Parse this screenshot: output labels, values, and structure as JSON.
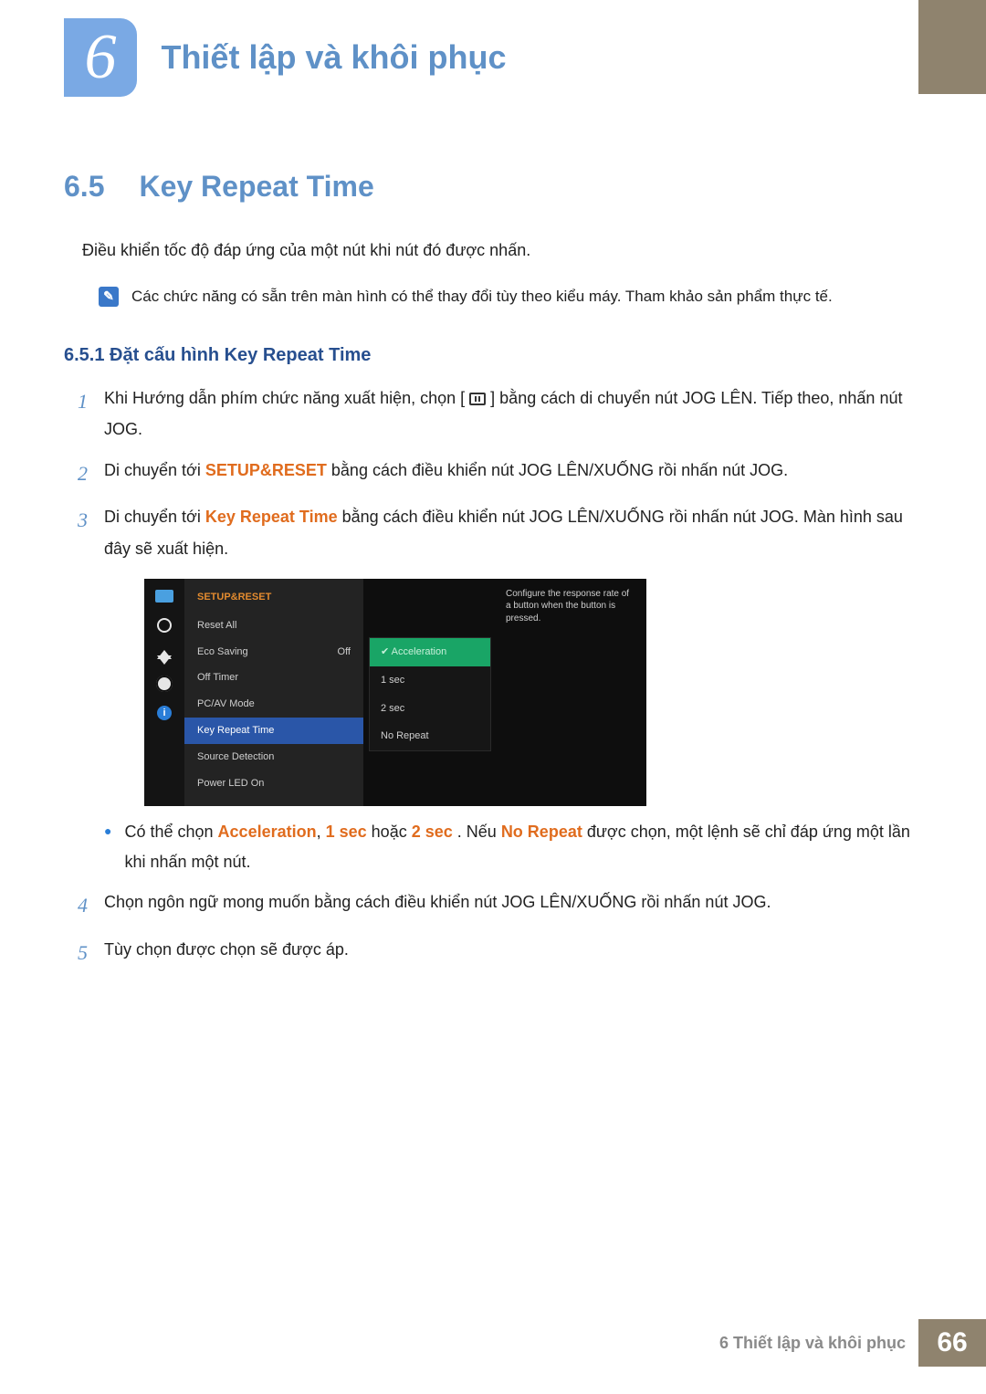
{
  "chapter": {
    "number": "6",
    "title": "Thiết lập và khôi phục"
  },
  "section": {
    "number": "6.5",
    "title": "Key Repeat Time"
  },
  "intro": "Điều khiển tốc độ đáp ứng của một nút khi nút đó được nhấn.",
  "note": "Các chức năng có sẵn trên màn hình có thể thay đổi tùy theo kiểu máy. Tham khảo sản phẩm thực tế.",
  "subsection": "6.5.1  Đặt cấu hình Key Repeat Time",
  "steps": {
    "s1a": "Khi Hướng dẫn phím chức năng xuất hiện, chọn [",
    "s1b": "] bằng cách di chuyển nút JOG LÊN. Tiếp theo, nhấn nút JOG.",
    "s2a": "Di chuyển tới ",
    "s2b": " bằng cách điều khiển nút JOG LÊN/XUỐNG rồi nhấn nút JOG.",
    "s2_kw": "SETUP&RESET",
    "s3a": "Di chuyển tới ",
    "s3_kw": "Key Repeat Time",
    "s3b": " bằng cách điều khiển nút JOG LÊN/XUỐNG rồi nhấn nút JOG. Màn hình sau đây sẽ xuất hiện.",
    "bullet_a": "Có thể chọn ",
    "kw_accel": "Acceleration",
    "kw_1s": "1 sec",
    "kw_2s": "2 sec",
    "bullet_b": " hoặc ",
    "bullet_c": ". Nếu ",
    "kw_nr": "No Repeat",
    "bullet_d": " được chọn, một lệnh sẽ chỉ đáp ứng một lần khi nhấn một nút.",
    "s4": "Chọn ngôn ngữ mong muốn bằng cách điều khiển nút JOG LÊN/XUỐNG rồi nhấn nút JOG.",
    "s5": "Tùy chọn được chọn sẽ được áp."
  },
  "osd": {
    "header": "SETUP&RESET",
    "menu": [
      {
        "label": "Reset All",
        "value": ""
      },
      {
        "label": "Eco Saving",
        "value": "Off"
      },
      {
        "label": "Off Timer",
        "value": ""
      },
      {
        "label": "PC/AV Mode",
        "value": ""
      },
      {
        "label": "Key Repeat Time",
        "value": "",
        "selected": true
      },
      {
        "label": "Source Detection",
        "value": ""
      },
      {
        "label": "Power LED On",
        "value": ""
      }
    ],
    "options": [
      {
        "label": "Acceleration",
        "selected": true
      },
      {
        "label": "1 sec"
      },
      {
        "label": "2 sec"
      },
      {
        "label": "No Repeat"
      }
    ],
    "description": "Configure the response rate of a button when the button is pressed.",
    "info_glyph": "i"
  },
  "footer": {
    "caption": "6 Thiết lập và khôi phục",
    "page": "66"
  }
}
